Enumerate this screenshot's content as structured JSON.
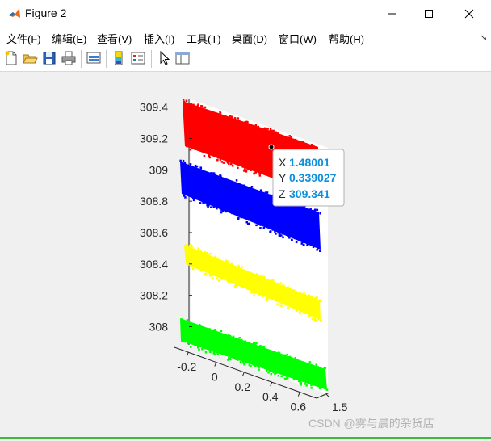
{
  "window": {
    "title": "Figure 2",
    "minimize_glyph": "─",
    "maximize_glyph": "☐",
    "close_glyph": "✕"
  },
  "menu": {
    "items": [
      {
        "label": "文件(",
        "accel": "F",
        "close": ")"
      },
      {
        "label": "编辑(",
        "accel": "E",
        "close": ")"
      },
      {
        "label": "查看(",
        "accel": "V",
        "close": ")"
      },
      {
        "label": "插入(",
        "accel": "I",
        "close": ")"
      },
      {
        "label": "工具(",
        "accel": "T",
        "close": ")"
      },
      {
        "label": "桌面(",
        "accel": "D",
        "close": ")"
      },
      {
        "label": "窗口(",
        "accel": "W",
        "close": ")"
      },
      {
        "label": "帮助(",
        "accel": "H",
        "close": ")"
      }
    ],
    "overflow_glyph": "↘"
  },
  "toolbar": {
    "icons": [
      "new-figure-icon",
      "open-file-icon",
      "save-icon",
      "print-icon",
      "link-plot-icon",
      "insert-colorbar-icon",
      "insert-legend-icon",
      "pointer-icon",
      "property-inspector-icon"
    ]
  },
  "chart_data": {
    "type": "scatter",
    "projection": "3d",
    "xlabel": "",
    "ylabel": "",
    "zlabel": "",
    "title": "",
    "x_ticks": [
      "1.5"
    ],
    "y_ticks": [
      "-0.2",
      "0",
      "0.2",
      "0.4",
      "0.6"
    ],
    "z_ticks": [
      "308",
      "308.2",
      "308.4",
      "308.6",
      "308.8",
      "309",
      "309.2",
      "309.4"
    ],
    "zlim": [
      307.9,
      309.45
    ],
    "grid": false,
    "series": [
      {
        "color": "#ff0000",
        "z_band": [
          309.25,
          309.45
        ]
      },
      {
        "color": "#0000ff",
        "z_band": [
          308.8,
          309.05
        ]
      },
      {
        "color": "#ffff00",
        "z_band": [
          308.25,
          308.5
        ]
      },
      {
        "color": "#00ff00",
        "z_band": [
          307.95,
          308.05
        ]
      }
    ],
    "datatip": {
      "x_label": "X",
      "x_value": "1.48001",
      "y_label": "Y",
      "y_value": "0.339027",
      "z_label": "Z",
      "z_value": "309.341"
    }
  },
  "watermark": "CSDN @雾与晨的杂货店"
}
